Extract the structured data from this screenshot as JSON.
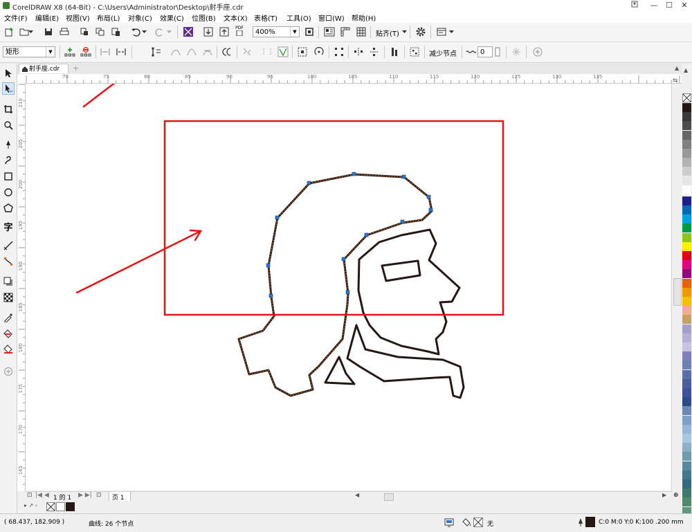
{
  "window": {
    "title": "CorelDRAW X8 (64-Bit) - C:\\Users\\Administrator\\Desktop\\射手座.cdr",
    "minimize": "—",
    "maximize": "☐",
    "close": "✕"
  },
  "menu": [
    "文件(F)",
    "编辑(E)",
    "视图(V)",
    "布局(L)",
    "对象(C)",
    "效果(C)",
    "位图(B)",
    "文本(X)",
    "表格(T)",
    "工具(O)",
    "窗口(W)",
    "帮助(H)"
  ],
  "standard_toolbar": {
    "zoom_value": "400%",
    "snap_label": "贴齐(T)",
    "pdf_label": "PDF"
  },
  "property_bar": {
    "shape_select": "矩形",
    "reduce_nodes_label": "减少节点",
    "smoothing_value": "0"
  },
  "document": {
    "tab_name": "射手座.cdr",
    "add_tab": "+"
  },
  "rulers": {
    "horizontal": [
      "70",
      "75",
      "80",
      "85",
      "90",
      "95",
      "100",
      "105",
      "110",
      "115",
      "120",
      "125",
      "130",
      "135"
    ],
    "vertical": [
      "210",
      "205",
      "200",
      "195",
      "190",
      "185",
      "180",
      "175",
      "170",
      "165"
    ]
  },
  "page_nav": {
    "counter": "1 的 1",
    "page_tab": "页 1"
  },
  "status": {
    "coordinates": "( 68.437, 182.909 )",
    "selection_info": "曲线: 26 个节点",
    "fill_none": "无",
    "outline_info": "C:0 M:0 Y:0 K:100  .200 mm"
  },
  "colors": {
    "annotation_red": "#e41212",
    "node_blue": "#2f78c9",
    "outline_black": "#231815",
    "selected_curve_brown": "#7a3b14"
  },
  "palette": [
    "#231815",
    "#3a3a3a",
    "#4d4d4d",
    "#666666",
    "#808080",
    "#999999",
    "#b3b3b3",
    "#cccccc",
    "#e6e6e6",
    "#ffffff",
    "#1d2088",
    "#0068b7",
    "#00a0e9",
    "#009944",
    "#8fc31f",
    "#fff100",
    "#e60012",
    "#e4007f",
    "#920783",
    "#eb6100",
    "#f39800",
    "#fabe00",
    "#f6ad8f",
    "#c9a063",
    "#a4a1c9",
    "#b6b0d4",
    "#c8c3e0",
    "#7f7fbf",
    "#6b7fb8",
    "#5a6eaa",
    "#4a5d9c",
    "#3e509b",
    "#2e4a8a",
    "#6b87b5",
    "#7f9fcb",
    "#95b6d9",
    "#a9c9e1",
    "#8bb1c4",
    "#6e9db2",
    "#558aa0",
    "#3e7a90",
    "#2e6a80",
    "#3f7a6e",
    "#4f8a6e",
    "#5f9a7e",
    "#6faa8e"
  ]
}
